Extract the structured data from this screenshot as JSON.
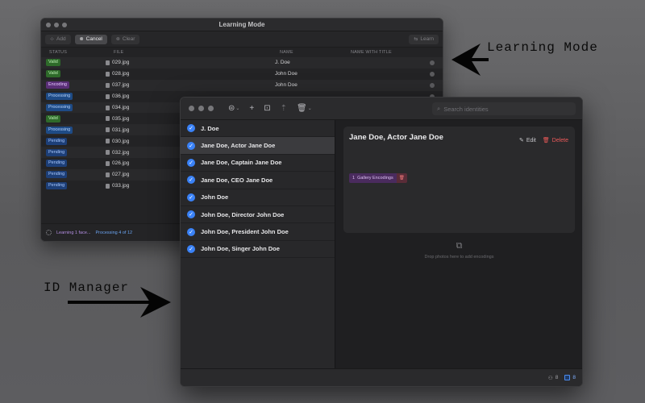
{
  "learning": {
    "title": "Learning Mode",
    "buttons": {
      "add": "Add",
      "cancel": "Cancel",
      "clear": "Clear",
      "learn": "Learn"
    },
    "columns": {
      "status": "STATUS",
      "file": "FILE",
      "name": "NAME",
      "name_with_title": "NAME WITH TITLE"
    },
    "rows": [
      {
        "status": "Valid",
        "file": "029.jpg",
        "name": "J. Doe"
      },
      {
        "status": "Valid",
        "file": "028.jpg",
        "name": "John Doe"
      },
      {
        "status": "Encoding",
        "file": "037.jpg",
        "name": "John Doe"
      },
      {
        "status": "Processing",
        "file": "036.jpg",
        "name": ""
      },
      {
        "status": "Processing",
        "file": "034.jpg",
        "name": ""
      },
      {
        "status": "Valid",
        "file": "035.jpg",
        "name": ""
      },
      {
        "status": "Processing",
        "file": "031.jpg",
        "name": ""
      },
      {
        "status": "Pending",
        "file": "030.jpg",
        "name": ""
      },
      {
        "status": "Pending",
        "file": "032.jpg",
        "name": ""
      },
      {
        "status": "Pending",
        "file": "026.jpg",
        "name": ""
      },
      {
        "status": "Pending",
        "file": "027.jpg",
        "name": ""
      },
      {
        "status": "Pending",
        "file": "033.jpg",
        "name": ""
      }
    ],
    "footer": {
      "learning": "Learning 1 face...",
      "processing": "Processing 4 of 12"
    }
  },
  "annotations": {
    "learning_mode": "Learning Mode",
    "id_manager": "ID Manager"
  },
  "id_manager": {
    "search_placeholder": "Search identities",
    "identities": [
      {
        "name": "J. Doe"
      },
      {
        "name": "Jane Doe, Actor Jane Doe"
      },
      {
        "name": "Jane Doe, Captain Jane Doe"
      },
      {
        "name": "Jane Doe, CEO Jane Doe"
      },
      {
        "name": "John Doe"
      },
      {
        "name": "John Doe, Director John Doe"
      },
      {
        "name": "John Doe, President John Doe"
      },
      {
        "name": "John Doe, Singer John Doe"
      }
    ],
    "selected_index": 1,
    "detail": {
      "name": "Jane Doe, Actor Jane Doe",
      "edit": "Edit",
      "delete": "Delete",
      "encodings_count": "1",
      "encodings_label": "Gallery Encodings",
      "drop_hint": "Drop photos here to add encodings"
    },
    "footer": {
      "people_count": "8",
      "encodings_count": "8"
    }
  },
  "colors": {
    "accent": "#3a82f7",
    "delete": "#ef5a5a",
    "valid": "#2e6a2a",
    "encoding": "#5a2f78",
    "processing": "#1e4b86"
  }
}
